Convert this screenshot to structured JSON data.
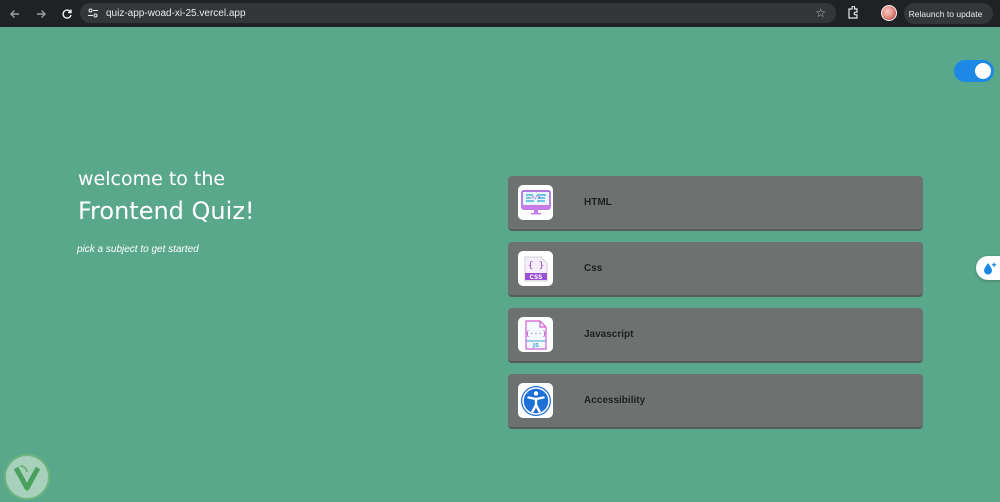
{
  "browser": {
    "url": "quiz-app-woad-xi-25.vercel.app",
    "relaunch_label": "Relaunch to update",
    "icons": [
      "back-icon",
      "forward-icon",
      "reload-icon",
      "site-info-icon",
      "bookmark-star-icon",
      "extensions-icon",
      "profile-avatar",
      "more-icon"
    ]
  },
  "theme_toggle": {
    "state": "on",
    "color": "#1e88e5"
  },
  "welcome": {
    "line1": "welcome to the",
    "line2": "Frontend Quiz!",
    "subtitle": "pick a subject to get started"
  },
  "subjects": [
    {
      "label": "HTML",
      "icon": "html-icon"
    },
    {
      "label": "Css",
      "icon": "css-icon"
    },
    {
      "label": "Javascript",
      "icon": "javascript-icon"
    },
    {
      "label": "Accessibility",
      "icon": "accessibility-icon"
    }
  ],
  "colors": {
    "background": "#5aa88c",
    "card": "#6d7270",
    "chrome": "#202124"
  }
}
